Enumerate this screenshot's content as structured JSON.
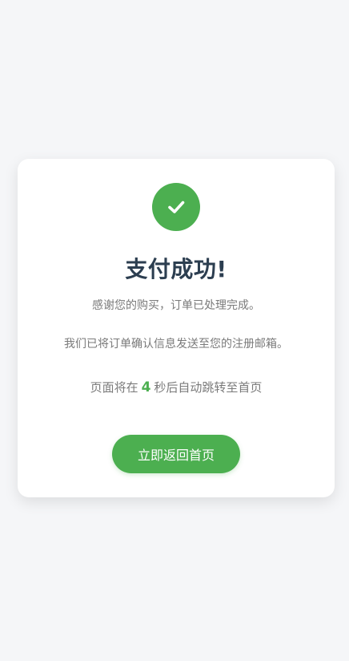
{
  "colors": {
    "background": "#f5f6f8",
    "accent": "#4caf50",
    "title": "#2c3e50",
    "text_muted": "#7a7a7a"
  },
  "success_icon": "check-icon",
  "title": "支付成功!",
  "thanks_message": "感谢您的购买，订单已处理完成。",
  "email_message": "我们已将订单确认信息发送至您的注册邮箱。",
  "countdown": {
    "prefix": "页面将在",
    "seconds": "4",
    "suffix": "秒后自动跳转至首页"
  },
  "home_button_label": "立即返回首页"
}
